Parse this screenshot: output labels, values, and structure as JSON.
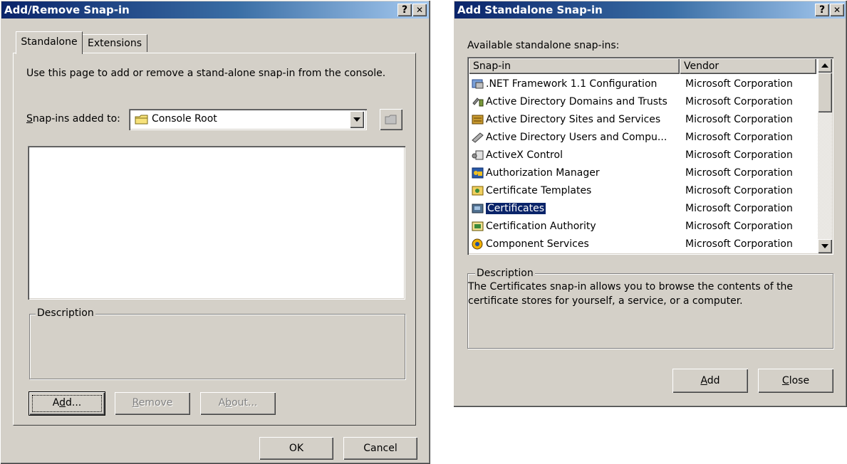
{
  "left_dialog": {
    "title": "Add/Remove Snap-in",
    "help_btn": "?",
    "close_btn": "✕",
    "tabs": [
      "Standalone",
      "Extensions"
    ],
    "instructions": "Use this page to add or remove a stand-alone snap-in from the console.",
    "snapins_added_label_prefix": "",
    "snapins_added_label_underline": "S",
    "snapins_added_label_rest": "nap-ins added to:",
    "combo_value": "Console Root",
    "description_label": "Description",
    "buttons": {
      "add_pre": "A",
      "add_u": "d",
      "add_post": "d...",
      "remove_u": "R",
      "remove_post": "emove",
      "about_pre": "A",
      "about_u": "b",
      "about_post": "out..."
    },
    "ok": "OK",
    "cancel": "Cancel"
  },
  "right_dialog": {
    "title": "Add Standalone Snap-in",
    "help_btn": "?",
    "close_btn": "✕",
    "available_label": "Available standalone snap-ins:",
    "columns": [
      "Snap-in",
      "Vendor"
    ],
    "rows": [
      {
        "name": ".NET Framework 1.1 Configuration",
        "vendor": "Microsoft Corporation",
        "icon": "net-framework-icon"
      },
      {
        "name": "Active Directory Domains and Trusts",
        "vendor": "Microsoft Corporation",
        "icon": "domains-trusts-icon"
      },
      {
        "name": "Active Directory Sites and Services",
        "vendor": "Microsoft Corporation",
        "icon": "sites-services-icon"
      },
      {
        "name": "Active Directory Users and Compu...",
        "vendor": "Microsoft Corporation",
        "icon": "users-computers-icon"
      },
      {
        "name": "ActiveX Control",
        "vendor": "Microsoft Corporation",
        "icon": "activex-icon"
      },
      {
        "name": "Authorization Manager",
        "vendor": "Microsoft Corporation",
        "icon": "authorization-icon"
      },
      {
        "name": "Certificate Templates",
        "vendor": "Microsoft Corporation",
        "icon": "certificate-templates-icon"
      },
      {
        "name": "Certificates",
        "vendor": "Microsoft Corporation",
        "icon": "certificates-icon",
        "selected": true
      },
      {
        "name": "Certification Authority",
        "vendor": "Microsoft Corporation",
        "icon": "certification-authority-icon"
      },
      {
        "name": "Component Services",
        "vendor": "Microsoft Corporation",
        "icon": "component-services-icon"
      }
    ],
    "description_label": "Description",
    "description_text": "The Certificates snap-in allows you to browse the contents of the certificate stores for yourself, a service, or a computer.",
    "add_u": "A",
    "add_post": "dd",
    "close_u": "C",
    "close_post": "lose"
  }
}
